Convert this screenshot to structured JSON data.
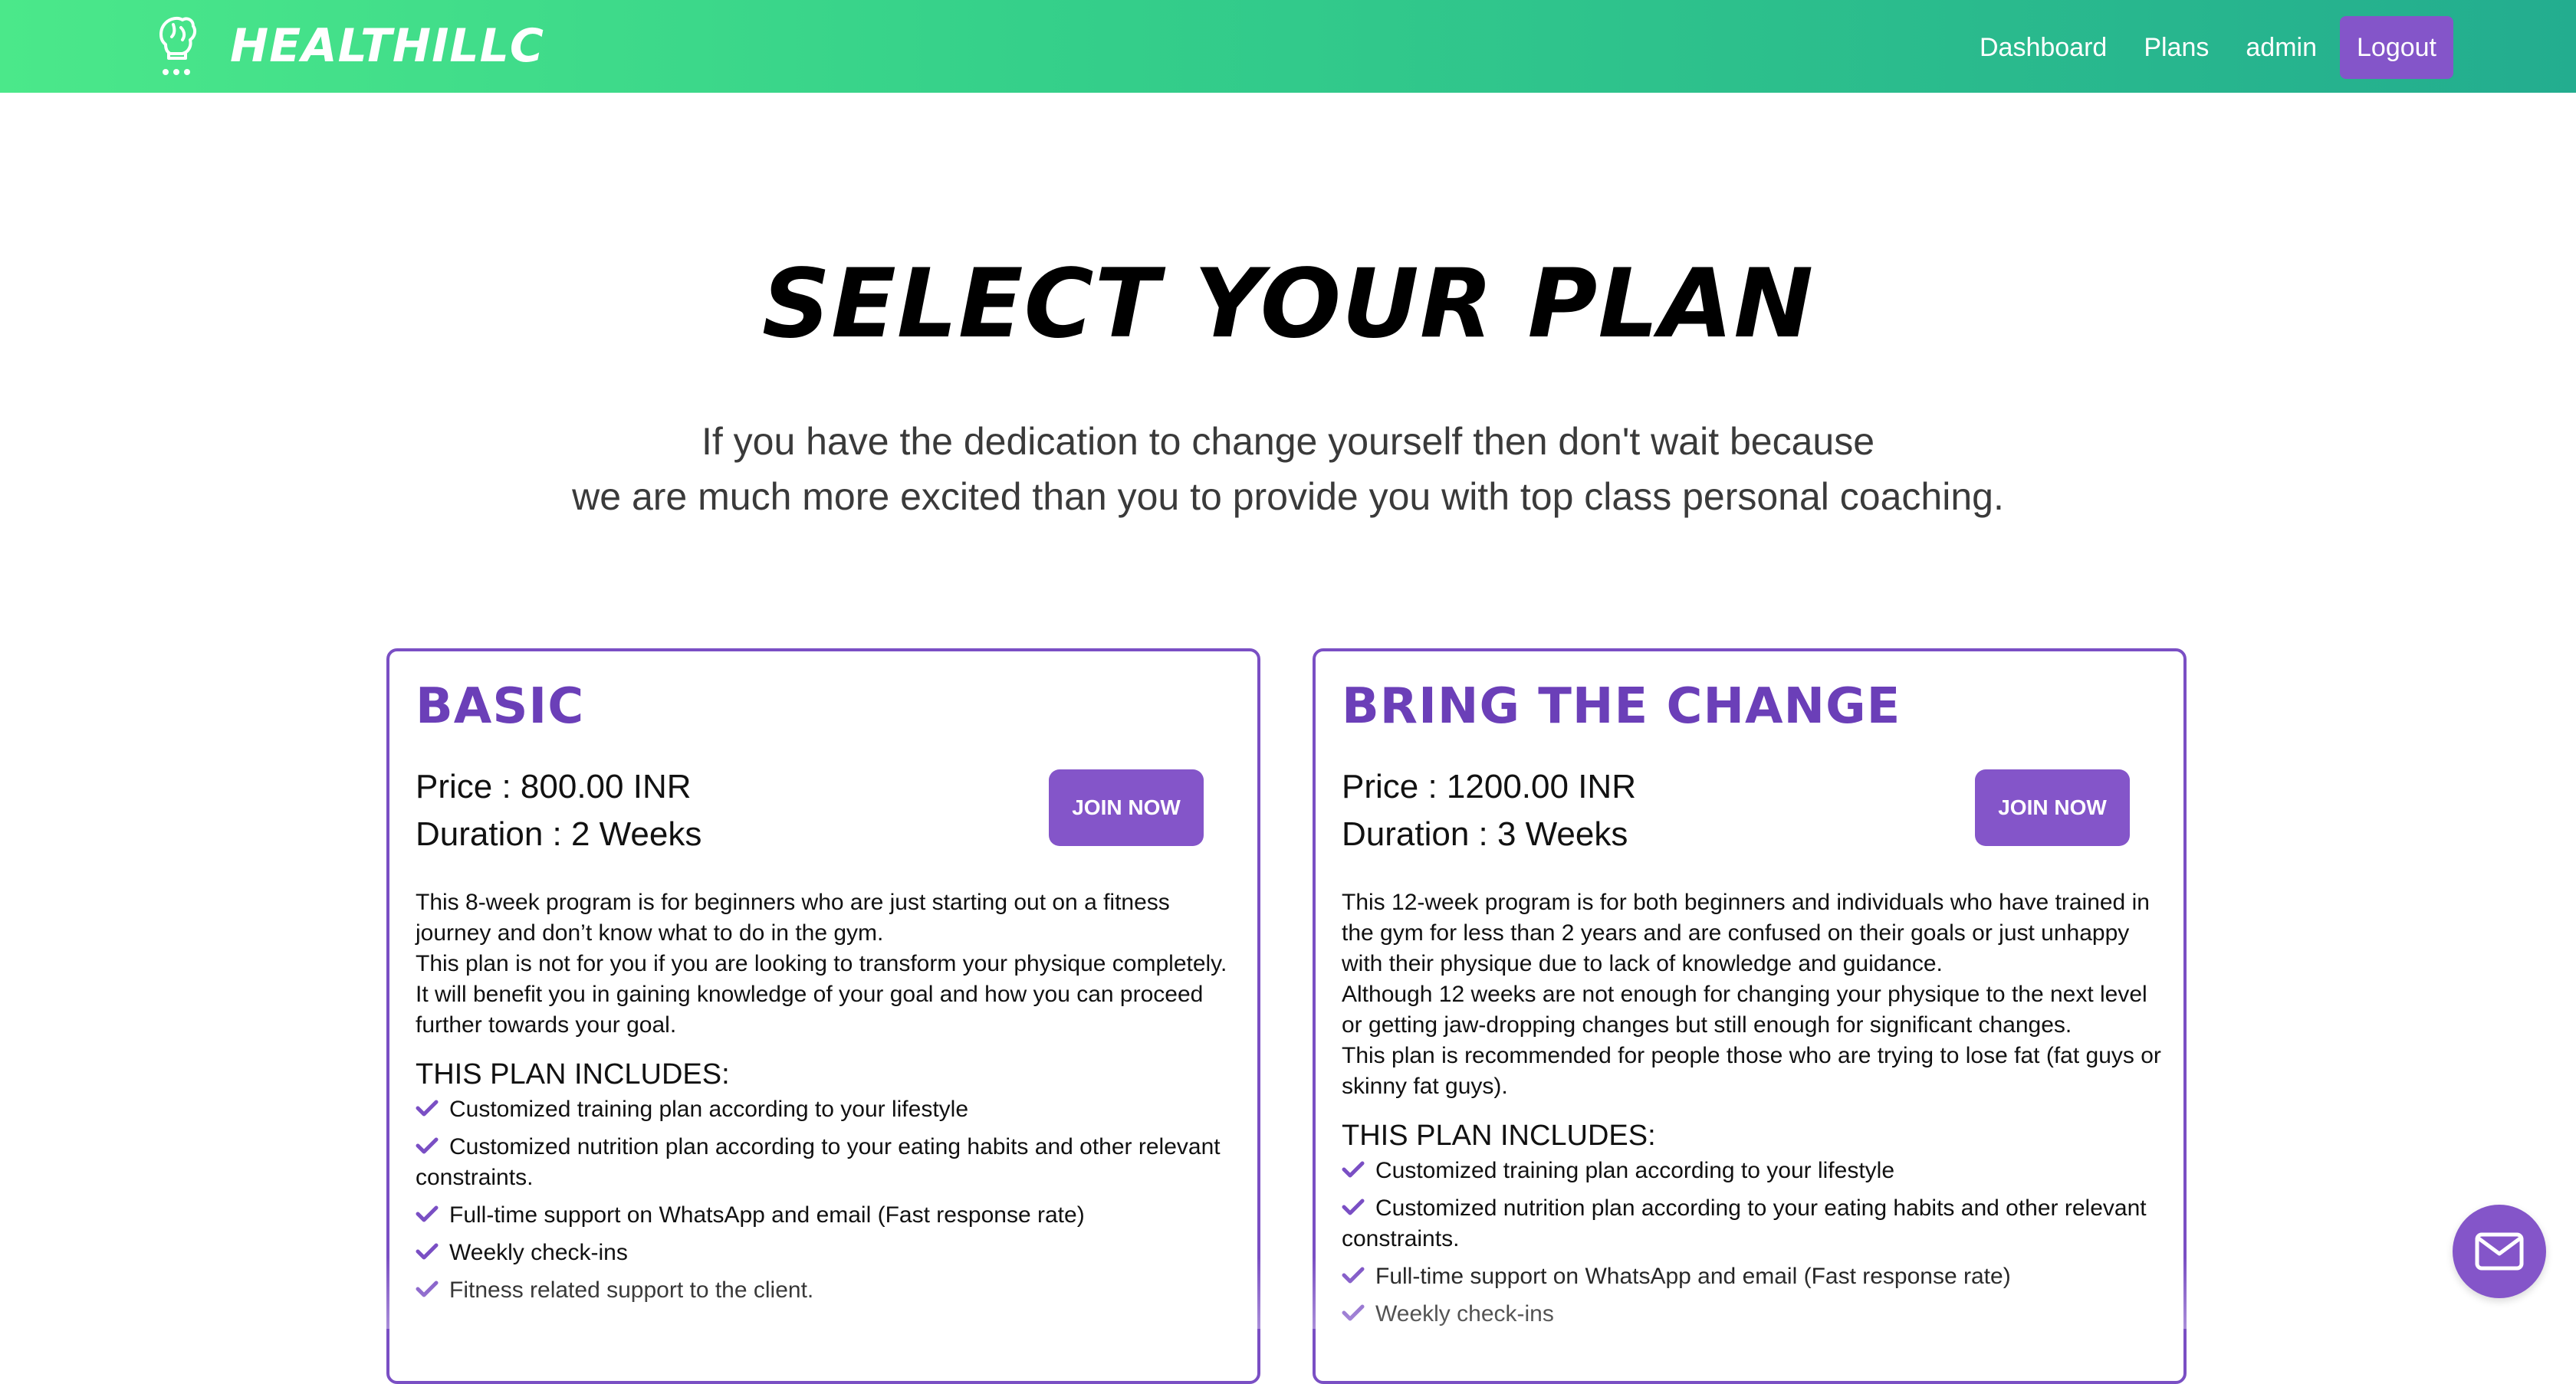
{
  "nav": {
    "brand": "HEALTHILLC",
    "links": [
      "Dashboard",
      "Plans",
      "admin"
    ],
    "logout": "Logout",
    "logo_icon": "flexed-arm-logo-icon"
  },
  "hero": {
    "title": "SELECT YOUR PLAN",
    "subtitle_line1": "If you have the dedication to change yourself then don't wait because",
    "subtitle_line2": "we are much more excited than you to provide you with top class personal coaching."
  },
  "plans": [
    {
      "name": "BASIC",
      "price": "Price : 800.00 INR",
      "duration": "Duration : 2 Weeks",
      "join_label": "JOIN NOW",
      "description": [
        "This 8-week program is for beginners who are just starting out on a fitness journey and don’t know what to do in the gym.",
        "This plan is not for you if you are looking to transform your physique completely. It will benefit you in gaining knowledge of your goal and how you can proceed further towards your goal."
      ],
      "includes_title": "THIS PLAN INCLUDES:",
      "features": [
        "Customized training plan according to your lifestyle",
        "Customized nutrition plan according to your eating habits and other relevant constraints.",
        "Full-time support on WhatsApp and email (Fast response rate)",
        "Weekly check-ins",
        "Fitness related support to the client."
      ]
    },
    {
      "name": "BRING THE CHANGE",
      "price": "Price : 1200.00 INR",
      "duration": "Duration : 3 Weeks",
      "join_label": "JOIN NOW",
      "description": [
        "This 12-week program is for both beginners and individuals who have trained in the gym for less than 2 years and are confused on their goals or just unhappy with their physique due to lack of knowledge and guidance.",
        "Although 12 weeks are not enough for changing your physique to the next level or getting jaw-dropping changes but still enough for significant changes.",
        "This plan is recommended for people those who are trying to lose fat (fat guys or skinny fat guys)."
      ],
      "includes_title": "THIS PLAN INCLUDES:",
      "features": [
        "Customized training plan according to your lifestyle",
        "Customized nutrition plan according to your eating habits and other relevant constraints.",
        "Full-time support on WhatsApp and email (Fast response rate)",
        "Weekly check-ins"
      ]
    }
  ],
  "contact": {
    "icon": "mail-icon"
  },
  "colors": {
    "accent": "#8455c9",
    "title_purple": "#6b3fb8",
    "nav_gradient_start": "#4be88a",
    "nav_gradient_end": "#23ad8f"
  }
}
